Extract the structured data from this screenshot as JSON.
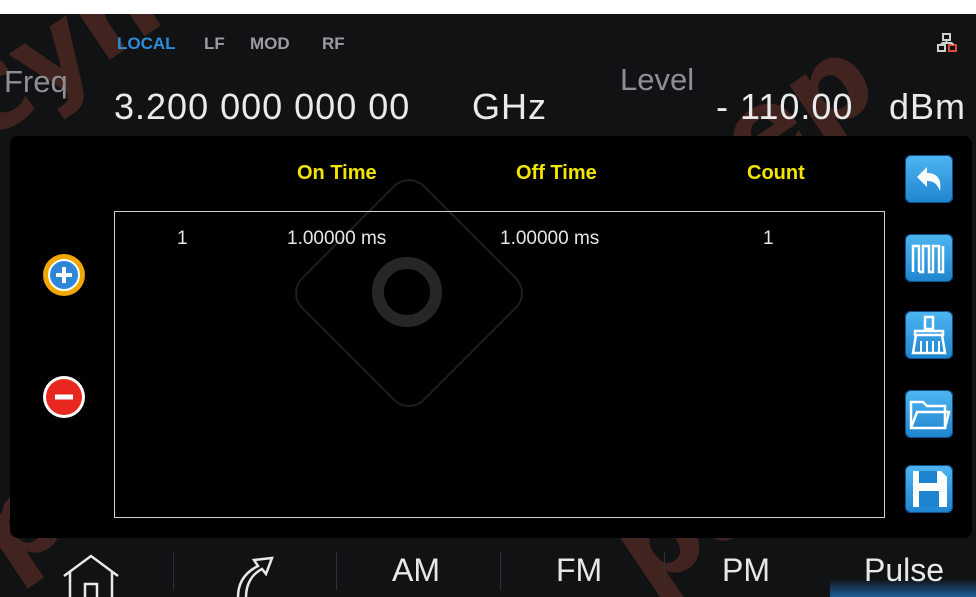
{
  "status_bar": {
    "local": "LOCAL",
    "lf": "LF",
    "mod": "MOD",
    "rf": "RF",
    "network_icon": "network-icon"
  },
  "freq": {
    "label": "Freq",
    "value": "3.200 000 000 00",
    "unit": "GHz"
  },
  "level": {
    "label": "Level",
    "value": "- 110.00",
    "unit": "dBm"
  },
  "table": {
    "headers": {
      "on_time": "On Time",
      "off_time": "Off Time",
      "count": "Count"
    },
    "rows": [
      {
        "index": "1",
        "on_time": "1.00000 ms",
        "off_time": "1.00000 ms",
        "count": "1"
      }
    ]
  },
  "side_buttons": [
    "back-icon",
    "pulse-train-icon",
    "clear-broom-icon",
    "open-folder-icon",
    "save-icon"
  ],
  "left_buttons": [
    "add-row-icon",
    "remove-row-icon"
  ],
  "tabs": {
    "home": "home-icon",
    "sweep": "arrow-icon",
    "am": "AM",
    "fm": "FM",
    "pm": "PM",
    "pulse": "Pulse"
  },
  "watermark": "cynepайс",
  "colors": {
    "accent": "#2f8bd6",
    "header_yellow": "#f2e500",
    "add": "#f0a800",
    "remove": "#e8281e"
  }
}
